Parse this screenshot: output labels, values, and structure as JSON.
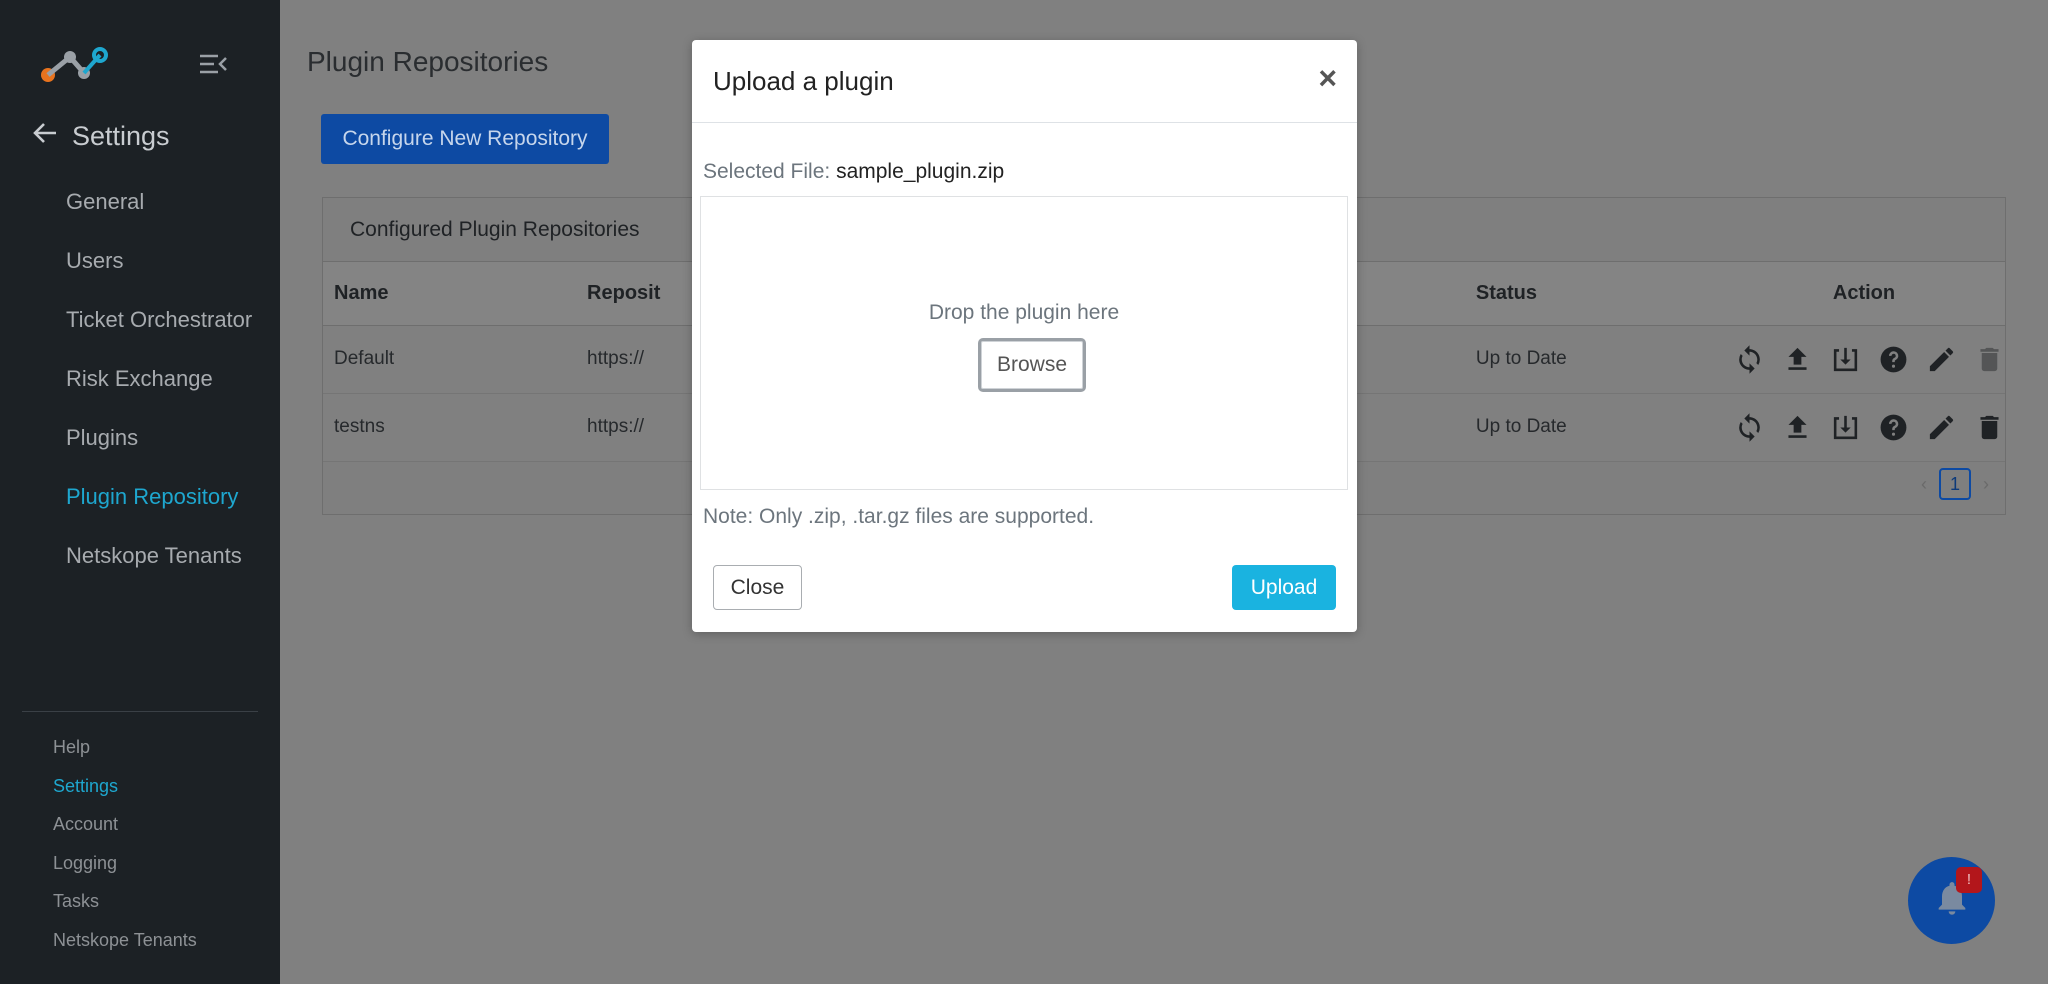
{
  "sidebar": {
    "settings_label": "Settings",
    "items": [
      {
        "label": "General",
        "active": false
      },
      {
        "label": "Users",
        "active": false
      },
      {
        "label": "Ticket Orchestrator",
        "active": false
      },
      {
        "label": "Risk Exchange",
        "active": false
      },
      {
        "label": "Plugins",
        "active": false
      },
      {
        "label": "Plugin Repository",
        "active": true
      },
      {
        "label": "Netskope Tenants",
        "active": false
      }
    ],
    "footer_items": [
      {
        "label": "Help",
        "active": false
      },
      {
        "label": "Settings",
        "active": true
      },
      {
        "label": "Account",
        "active": false
      },
      {
        "label": "Logging",
        "active": false
      },
      {
        "label": "Tasks",
        "active": false
      },
      {
        "label": "Netskope Tenants",
        "active": false
      }
    ]
  },
  "main": {
    "title": "Plugin Repositories",
    "configure_button": "Configure New Repository",
    "card_title": "Configured Plugin Repositories",
    "columns": {
      "name": "Name",
      "repo": "Reposit",
      "status": "Status",
      "action": "Action"
    },
    "rows": [
      {
        "name": "Default",
        "repo": "https://",
        "status": "Up to Date",
        "delete_enabled": false
      },
      {
        "name": "testns",
        "repo": "https://",
        "status": "Up to Date",
        "delete_enabled": true
      }
    ],
    "pagination": {
      "current": "1",
      "prev": "‹",
      "next": "›"
    }
  },
  "notifications": {
    "badge": "!"
  },
  "modal": {
    "title": "Upload a plugin",
    "close_symbol": "×",
    "selected_file_label": "Selected File:",
    "selected_file_name": "sample_plugin.zip",
    "drop_text": "Drop the plugin here",
    "browse_label": "Browse",
    "note": "Note: Only .zip, .tar.gz files are supported.",
    "close_label": "Close",
    "upload_label": "Upload"
  },
  "colors": {
    "accent": "#1ea7cf",
    "primary_button": "#0d4aa3",
    "upload_button": "#1ab3e0",
    "sidebar_bg": "#1c2125",
    "overlay": "#808080"
  },
  "icons": {
    "logo": "netskope-logo",
    "collapse": "menu-collapse-icon",
    "back": "arrow-left-icon",
    "row_actions": [
      "sync-icon",
      "upload-icon",
      "download-icon",
      "help-icon",
      "edit-icon",
      "trash-icon"
    ],
    "notification": "bell-icon"
  }
}
